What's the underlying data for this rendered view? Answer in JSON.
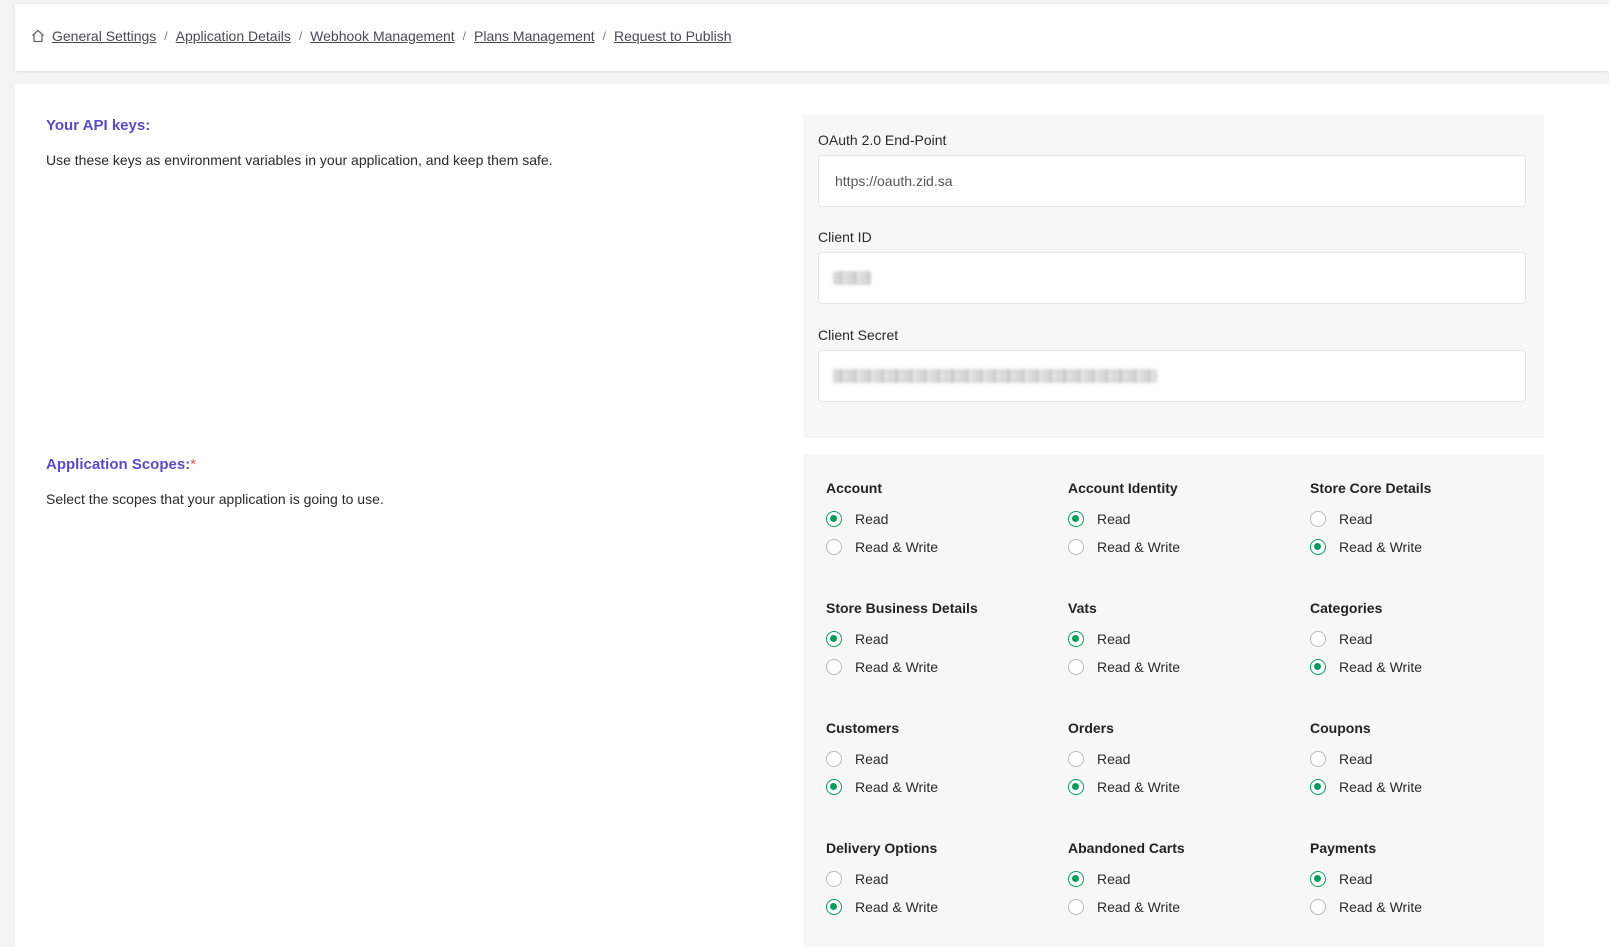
{
  "breadcrumb": {
    "items": [
      "General Settings",
      "Application Details",
      "Webhook Management",
      "Plans Management",
      "Request to Publish"
    ],
    "separator": "/"
  },
  "api_keys": {
    "title": "Your API keys:",
    "description": "Use these keys as environment variables in your application, and keep them safe.",
    "oauth_label": "OAuth 2.0 End-Point",
    "oauth_value": "https://oauth.zid.sa",
    "client_id_label": "Client ID",
    "client_secret_label": "Client Secret"
  },
  "scopes": {
    "title": "Application Scopes:",
    "required_mark": "*",
    "description": "Select the scopes that your application is going to use.",
    "read_label": "Read",
    "rw_label": "Read & Write",
    "items": [
      {
        "name": "Account",
        "selected": "read"
      },
      {
        "name": "Account Identity",
        "selected": "read"
      },
      {
        "name": "Store Core Details",
        "selected": "rw"
      },
      {
        "name": "Store Business Details",
        "selected": "read"
      },
      {
        "name": "Vats",
        "selected": "read"
      },
      {
        "name": "Categories",
        "selected": "rw"
      },
      {
        "name": "Customers",
        "selected": "rw"
      },
      {
        "name": "Orders",
        "selected": "rw"
      },
      {
        "name": "Coupons",
        "selected": "rw"
      },
      {
        "name": "Delivery Options",
        "selected": "rw"
      },
      {
        "name": "Abandoned Carts",
        "selected": "read"
      },
      {
        "name": "Payments",
        "selected": "read"
      }
    ]
  },
  "colors": {
    "accent": "#5b4bc4",
    "radio_selected": "#0c9b5c",
    "required": "#e25555"
  }
}
